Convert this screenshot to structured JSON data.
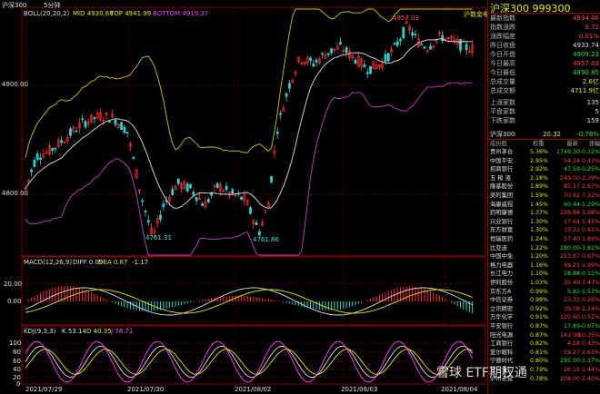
{
  "chart": {
    "symbol": "沪深300",
    "period": "5分钟",
    "boll_label": "BOLL(20,20,2)",
    "boll_mid": "MID 4930.68",
    "boll_top": "TOP 4941.99",
    "boll_bottom": "BOTTOM 4919.37",
    "macd_label": "MACD(12,26,9)",
    "macd_diff": "DIFF 0.09",
    "macd_dea": "DEA 0.67",
    "macd_val": "-1.17",
    "kdj_label": "KDJ(9,3,3)",
    "kdj_k": "K 53.14",
    "kdj_d": "D 40.35",
    "kdj_j": "J 78.71",
    "price_levels": [
      "4900.00",
      "4800.00"
    ],
    "macd_levels": [
      "0.00",
      "20.00"
    ],
    "kdj_levels": [
      "100",
      "80",
      "60",
      "40",
      "20",
      "0"
    ],
    "dates": [
      "2021/07/29",
      "2021/07/30",
      "2021/08/02",
      "2021/08/03",
      "2021/08/04"
    ],
    "annotations": {
      "high": "4957.03",
      "low1": "4761.31",
      "low2": "4761.86",
      "tag": "沪数金电"
    },
    "colors": {
      "up": "#ff3030",
      "down": "#30d0d0",
      "mid": "#e6e600",
      "band": "#c040c0",
      "grid": "#800000"
    }
  },
  "side": {
    "title": "沪深300  999300",
    "quote": [
      {
        "label": "最新指数",
        "value": "4934.46",
        "cls": "up"
      },
      {
        "label": "指数涨跌",
        "value": "0.72",
        "cls": "up"
      },
      {
        "label": "涨跌幅度",
        "value": "0.01%",
        "cls": "up"
      },
      {
        "label": "昨日收盘",
        "value": "4933.74",
        "cls": "wh"
      },
      {
        "label": "今日开盘",
        "value": "4909.23",
        "cls": "dn"
      },
      {
        "label": "今日最高",
        "value": "4957.03",
        "cls": "up"
      },
      {
        "label": "今日最低",
        "value": "4890.85",
        "cls": "dn"
      },
      {
        "label": "总成交量",
        "value": "2.6亿",
        "cls": "yl"
      },
      {
        "label": "总成交额",
        "value": "4711.9亿",
        "cls": "yl"
      },
      {
        "label": "上涨家数",
        "value": "135",
        "cls": "wh"
      },
      {
        "label": "平盘家数",
        "value": "5",
        "cls": "wh"
      },
      {
        "label": "下跌家数",
        "value": "159",
        "cls": "wh"
      }
    ],
    "mini_row": {
      "label": "沪深300",
      "v1": "20.32",
      "v2": "-0.78%"
    },
    "headers": [
      "成份股",
      "权重",
      "最新",
      "涨幅"
    ],
    "stocks": [
      [
        "贵州茅台",
        "5.36%",
        "1749.30",
        "-0.32%"
      ],
      [
        "中国平安",
        "2.95%",
        "54.24",
        "0.43%"
      ],
      [
        "招商银行",
        "2.92%",
        "47.59",
        "-0.25%"
      ],
      [
        "五 粮 液",
        "2.18%",
        "249.00",
        "2.39%"
      ],
      [
        "隆基股份",
        "1.89%",
        "85.17",
        "1.67%"
      ],
      [
        "美的集团",
        "1.59%",
        "70.92",
        "7.32%"
      ],
      [
        "海康威视",
        "1.45%",
        "60.44",
        "-1.29%"
      ],
      [
        "药明康德",
        "1.37%",
        "158.88",
        "3.98%"
      ],
      [
        "兴业银行",
        "1.30%",
        "17.64",
        "1.45%"
      ],
      [
        "东方财富",
        "1.30%",
        "33.22",
        "0.61%"
      ],
      [
        "恒瑞医药",
        "1.24%",
        "57.40",
        "1.89%"
      ],
      [
        "比亚迪",
        "1.22%",
        "280.00",
        "-3.81%"
      ],
      [
        "中国中免",
        "1.20%",
        "253.87",
        "0.67%"
      ],
      [
        "格力电器",
        "1.16%",
        "49.21",
        "1.99%"
      ],
      [
        "长江电力",
        "1.10%",
        "18.88",
        "-0.11%"
      ],
      [
        "伊利股份",
        "1.03%",
        "35.49",
        "3.47%"
      ],
      [
        "京东方A",
        "0.99%",
        "5.81",
        "-1.53%"
      ],
      [
        "中信证券",
        "0.98%",
        "23.33",
        "0.26%"
      ],
      [
        "立讯精密",
        "0.92%",
        "39.08",
        "2.14%"
      ],
      [
        "万华化学",
        "0.91%",
        "120.60",
        "0.51%"
      ],
      [
        "平安银行",
        "0.87%",
        "17.89",
        "-0.67%"
      ],
      [
        "阳光电源",
        "0.87%",
        "143.98",
        "10.35%"
      ],
      [
        "工商银行",
        "0.82%",
        "4.58",
        "0.43%"
      ],
      [
        "爱尔眼科",
        "0.81%",
        "59.27",
        "2.63%"
      ],
      [
        "宁德时代",
        "0.80%",
        "295.00",
        "-1.17%"
      ],
      [
        "三一重工",
        "0.79%",
        "26.15",
        "1.44%"
      ],
      [
        "泸州老窖",
        "0.78%",
        "208.00",
        "2.40%"
      ]
    ]
  },
  "watermark": "雪球  ETF期权通"
}
